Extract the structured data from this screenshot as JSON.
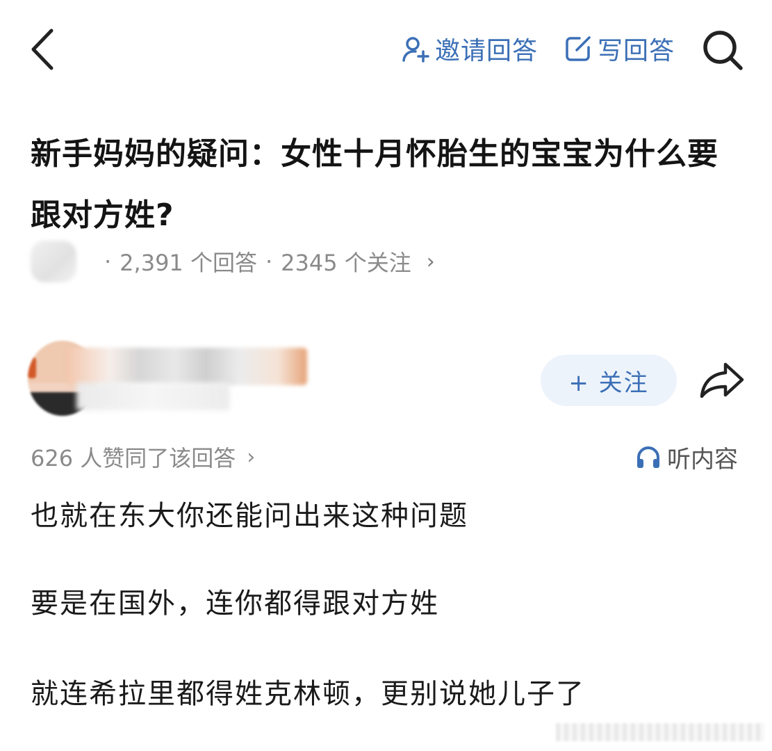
{
  "header": {
    "invite_label": "邀请回答",
    "write_label": "写回答",
    "icons": {
      "back": "chevron-left-icon",
      "invite": "person-plus-icon",
      "write": "edit-icon",
      "search": "search-icon"
    }
  },
  "question": {
    "title": "新手妈妈的疑问：女性十月怀胎生的宝宝为什么要跟对方姓?",
    "answers_count": "2,391 个回答",
    "followers_count": "2345 个关注",
    "separator": "·",
    "chevron": "›"
  },
  "author": {
    "follow_label": "+ 关注"
  },
  "answer": {
    "likes_text": "626 人赞同了该回答",
    "likes_chevron": "›",
    "listen_label": "听内容",
    "paragraphs": [
      "也就在东大你还能问出来这种问题",
      "要是在国外，连你都得跟对方姓",
      "就连希拉里都得姓克林顿，更别说她儿子了"
    ]
  },
  "colors": {
    "accent": "#3b6fb6",
    "follow_bg": "#edf3fb",
    "meta_text": "#8a8a8a",
    "body_text": "#1a1a1a"
  }
}
